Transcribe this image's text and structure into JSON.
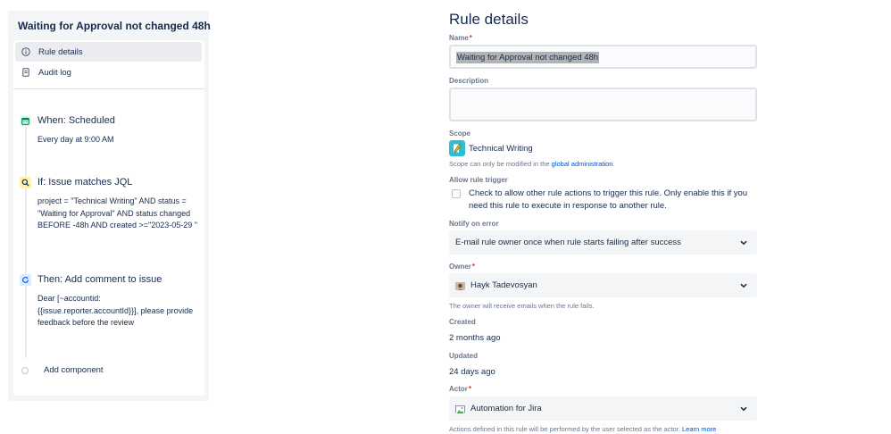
{
  "sidebar": {
    "rule_title": "Waiting for Approval not changed 48h",
    "nav": [
      {
        "label": "Rule details",
        "icon": "info-icon",
        "active": true
      },
      {
        "label": "Audit log",
        "icon": "document-icon",
        "active": false
      }
    ],
    "components": [
      {
        "title": "When: Scheduled",
        "description": "Every day at 9:00 AM",
        "icon": "calendar-icon",
        "color": "#00875a"
      },
      {
        "title": "If: Issue matches JQL",
        "description": "project = \"Technical Writing\" AND status = \"Waiting for Approval\" AND status changed BEFORE -48h AND created >=\"2023-05-29 \"",
        "icon": "search-icon",
        "color": "#ff991f"
      },
      {
        "title": "Then: Add comment to issue",
        "description": "Dear [~accountid: {{issue.reporter.accountId}}], please provide feedback before the review",
        "icon": "refresh-icon",
        "color": "#0065ff"
      }
    ],
    "add_component": "Add component"
  },
  "form": {
    "title": "Rule details",
    "name_label": "Name",
    "name_value": "Waiting for Approval not changed 48h",
    "description_label": "Description",
    "scope_label": "Scope",
    "scope_name": "Technical Writing",
    "scope_help_prefix": "Scope can only be modified in the",
    "scope_help_link": "global administration",
    "scope_help_suffix": ".",
    "allow_trigger_label": "Allow rule trigger",
    "allow_trigger_text": "Check to allow other rule actions to trigger this rule. Only enable this if you need this rule to execute in response to another rule.",
    "notify_label": "Notify on error",
    "notify_value": "E-mail rule owner once when rule starts failing after success",
    "owner_label": "Owner",
    "owner_value": "Hayk Tadevosyan",
    "owner_help": "The owner will receive emails when the rule fails.",
    "created_label": "Created",
    "created_value": "2 months ago",
    "updated_label": "Updated",
    "updated_value": "24 days ago",
    "actor_label": "Actor",
    "actor_value": "Automation for Jira",
    "actor_help_prefix": "Actions defined in this rule will be performed by the user selected as the actor.",
    "actor_help_link": "Learn more",
    "required_mark": "*"
  },
  "colors": {
    "accent": "#0052cc",
    "scope_avatar": "#2fbdd6",
    "required": "#de350b"
  }
}
